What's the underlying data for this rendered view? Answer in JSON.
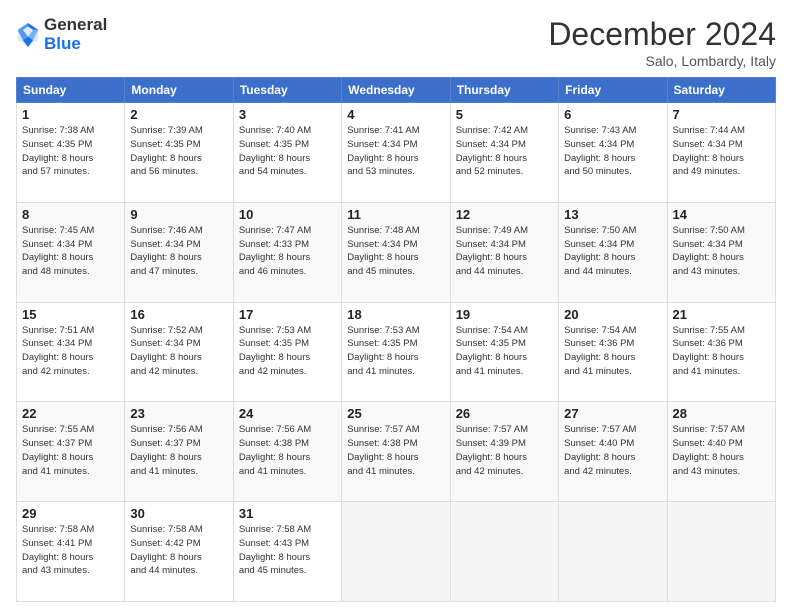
{
  "header": {
    "logo_line1": "General",
    "logo_line2": "Blue",
    "month": "December 2024",
    "location": "Salo, Lombardy, Italy"
  },
  "days_of_week": [
    "Sunday",
    "Monday",
    "Tuesday",
    "Wednesday",
    "Thursday",
    "Friday",
    "Saturday"
  ],
  "weeks": [
    [
      {
        "day": "1",
        "info": "Sunrise: 7:38 AM\nSunset: 4:35 PM\nDaylight: 8 hours\nand 57 minutes."
      },
      {
        "day": "2",
        "info": "Sunrise: 7:39 AM\nSunset: 4:35 PM\nDaylight: 8 hours\nand 56 minutes."
      },
      {
        "day": "3",
        "info": "Sunrise: 7:40 AM\nSunset: 4:35 PM\nDaylight: 8 hours\nand 54 minutes."
      },
      {
        "day": "4",
        "info": "Sunrise: 7:41 AM\nSunset: 4:34 PM\nDaylight: 8 hours\nand 53 minutes."
      },
      {
        "day": "5",
        "info": "Sunrise: 7:42 AM\nSunset: 4:34 PM\nDaylight: 8 hours\nand 52 minutes."
      },
      {
        "day": "6",
        "info": "Sunrise: 7:43 AM\nSunset: 4:34 PM\nDaylight: 8 hours\nand 50 minutes."
      },
      {
        "day": "7",
        "info": "Sunrise: 7:44 AM\nSunset: 4:34 PM\nDaylight: 8 hours\nand 49 minutes."
      }
    ],
    [
      {
        "day": "8",
        "info": "Sunrise: 7:45 AM\nSunset: 4:34 PM\nDaylight: 8 hours\nand 48 minutes."
      },
      {
        "day": "9",
        "info": "Sunrise: 7:46 AM\nSunset: 4:34 PM\nDaylight: 8 hours\nand 47 minutes."
      },
      {
        "day": "10",
        "info": "Sunrise: 7:47 AM\nSunset: 4:33 PM\nDaylight: 8 hours\nand 46 minutes."
      },
      {
        "day": "11",
        "info": "Sunrise: 7:48 AM\nSunset: 4:34 PM\nDaylight: 8 hours\nand 45 minutes."
      },
      {
        "day": "12",
        "info": "Sunrise: 7:49 AM\nSunset: 4:34 PM\nDaylight: 8 hours\nand 44 minutes."
      },
      {
        "day": "13",
        "info": "Sunrise: 7:50 AM\nSunset: 4:34 PM\nDaylight: 8 hours\nand 44 minutes."
      },
      {
        "day": "14",
        "info": "Sunrise: 7:50 AM\nSunset: 4:34 PM\nDaylight: 8 hours\nand 43 minutes."
      }
    ],
    [
      {
        "day": "15",
        "info": "Sunrise: 7:51 AM\nSunset: 4:34 PM\nDaylight: 8 hours\nand 42 minutes."
      },
      {
        "day": "16",
        "info": "Sunrise: 7:52 AM\nSunset: 4:34 PM\nDaylight: 8 hours\nand 42 minutes."
      },
      {
        "day": "17",
        "info": "Sunrise: 7:53 AM\nSunset: 4:35 PM\nDaylight: 8 hours\nand 42 minutes."
      },
      {
        "day": "18",
        "info": "Sunrise: 7:53 AM\nSunset: 4:35 PM\nDaylight: 8 hours\nand 41 minutes."
      },
      {
        "day": "19",
        "info": "Sunrise: 7:54 AM\nSunset: 4:35 PM\nDaylight: 8 hours\nand 41 minutes."
      },
      {
        "day": "20",
        "info": "Sunrise: 7:54 AM\nSunset: 4:36 PM\nDaylight: 8 hours\nand 41 minutes."
      },
      {
        "day": "21",
        "info": "Sunrise: 7:55 AM\nSunset: 4:36 PM\nDaylight: 8 hours\nand 41 minutes."
      }
    ],
    [
      {
        "day": "22",
        "info": "Sunrise: 7:55 AM\nSunset: 4:37 PM\nDaylight: 8 hours\nand 41 minutes."
      },
      {
        "day": "23",
        "info": "Sunrise: 7:56 AM\nSunset: 4:37 PM\nDaylight: 8 hours\nand 41 minutes."
      },
      {
        "day": "24",
        "info": "Sunrise: 7:56 AM\nSunset: 4:38 PM\nDaylight: 8 hours\nand 41 minutes."
      },
      {
        "day": "25",
        "info": "Sunrise: 7:57 AM\nSunset: 4:38 PM\nDaylight: 8 hours\nand 41 minutes."
      },
      {
        "day": "26",
        "info": "Sunrise: 7:57 AM\nSunset: 4:39 PM\nDaylight: 8 hours\nand 42 minutes."
      },
      {
        "day": "27",
        "info": "Sunrise: 7:57 AM\nSunset: 4:40 PM\nDaylight: 8 hours\nand 42 minutes."
      },
      {
        "day": "28",
        "info": "Sunrise: 7:57 AM\nSunset: 4:40 PM\nDaylight: 8 hours\nand 43 minutes."
      }
    ],
    [
      {
        "day": "29",
        "info": "Sunrise: 7:58 AM\nSunset: 4:41 PM\nDaylight: 8 hours\nand 43 minutes."
      },
      {
        "day": "30",
        "info": "Sunrise: 7:58 AM\nSunset: 4:42 PM\nDaylight: 8 hours\nand 44 minutes."
      },
      {
        "day": "31",
        "info": "Sunrise: 7:58 AM\nSunset: 4:43 PM\nDaylight: 8 hours\nand 45 minutes."
      },
      {
        "day": "",
        "info": ""
      },
      {
        "day": "",
        "info": ""
      },
      {
        "day": "",
        "info": ""
      },
      {
        "day": "",
        "info": ""
      }
    ]
  ]
}
